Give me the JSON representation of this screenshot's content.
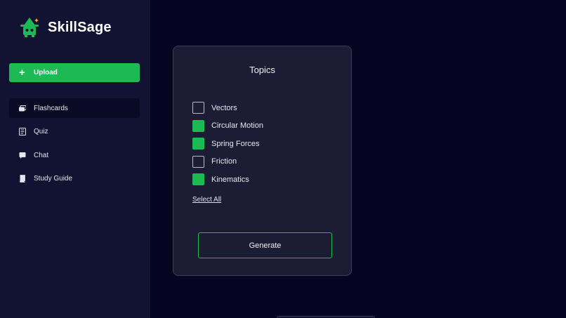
{
  "brand": {
    "name": "SkillSage"
  },
  "sidebar": {
    "upload_label": "Upload",
    "items": [
      {
        "label": "Flashcards",
        "icon": "cards-icon",
        "active": true
      },
      {
        "label": "Quiz",
        "icon": "document-icon",
        "active": false
      },
      {
        "label": "Chat",
        "icon": "chat-icon",
        "active": false
      },
      {
        "label": "Study Guide",
        "icon": "book-icon",
        "active": false
      }
    ]
  },
  "panel": {
    "title": "Topics",
    "topics": [
      {
        "label": "Vectors",
        "checked": false
      },
      {
        "label": "Circular Motion",
        "checked": true
      },
      {
        "label": "Spring Forces",
        "checked": true
      },
      {
        "label": "Friction",
        "checked": false
      },
      {
        "label": "Kinematics",
        "checked": true
      }
    ],
    "select_all_label": "Select All",
    "generate_label": "Generate"
  },
  "colors": {
    "accent": "#1db954",
    "background": "#05051f",
    "sidebar": "#121233",
    "panel": "#1c1c35"
  }
}
